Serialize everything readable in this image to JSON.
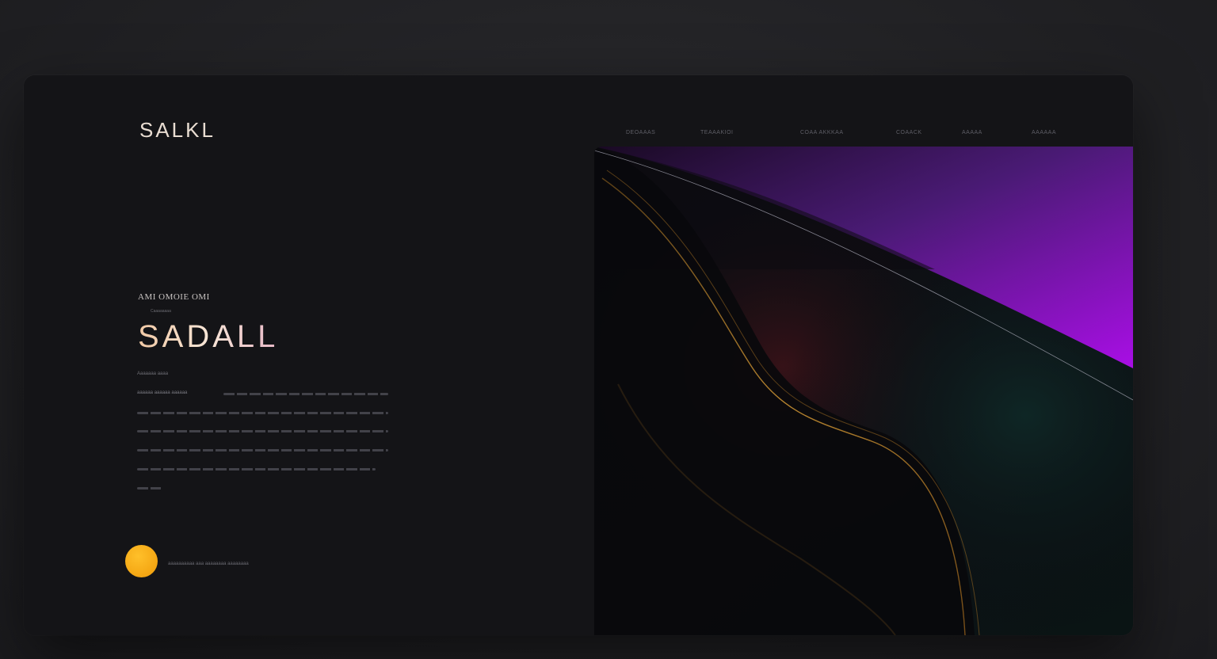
{
  "brand": {
    "logo": "SALKL"
  },
  "nav": {
    "items": [
      "DEOAAAS",
      "TEAAAKIOI",
      "COAA AKKKAA",
      "COAACK",
      "AAAAA",
      "AAAAAA"
    ]
  },
  "hero": {
    "eyebrow": "AMI OMOIE OMI",
    "eyebrow_sub": "Caaaaaaaa",
    "headline": "SADALL",
    "small_label": "Aaaaaaa aaaa",
    "paragraph_lead": "aaaaaa aaaaaa aaaaaa",
    "cta_label": "aaaaaaaaaa aaa aaaaaaaa aaaaaaaa"
  },
  "colors": {
    "card_bg": "#141417",
    "accent_dot": "#f4a613",
    "accent_purple": "#a40ee0",
    "accent_gold": "#c98a2a"
  },
  "icons": {
    "accent": "orange-circle"
  }
}
